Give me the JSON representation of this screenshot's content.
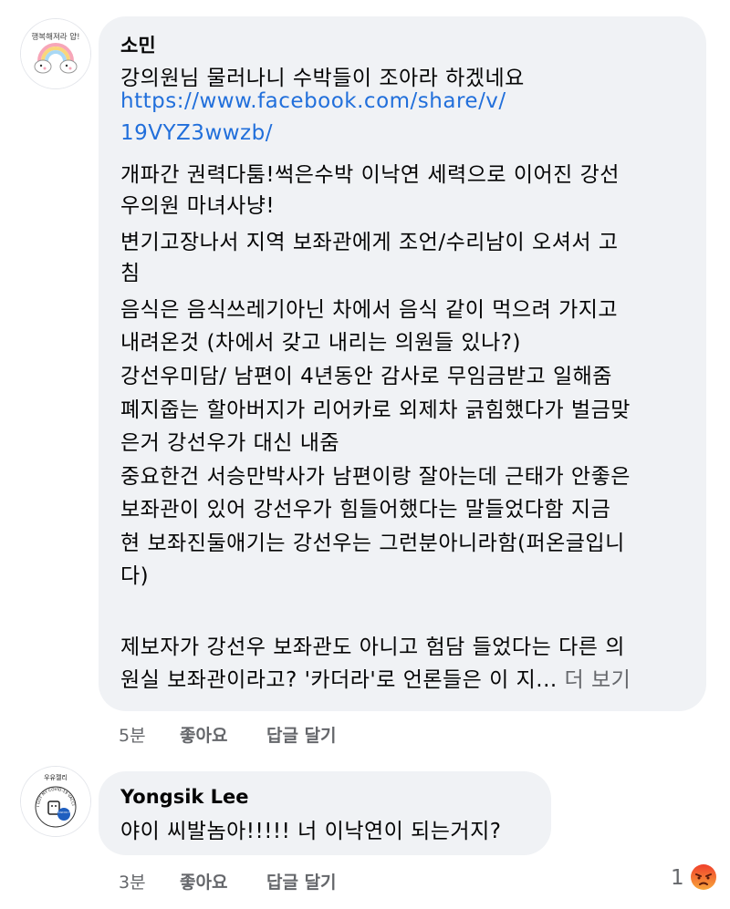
{
  "comments": [
    {
      "author": "소민",
      "avatar_icon": "rainbow-unicorn-avatar-icon",
      "avatar_text": "행복해져라 얍!",
      "text": {
        "l1": "강의원님 물러나니 수박들이 조아라 하겠네요",
        "l2": "https://www.facebook.com/share/v/",
        "l3": "19VYZ3wwzb/",
        "l4": "개파간 권력다툼!썩은수박 이낙연 세력으로 이어진 강선",
        "l5": "우의원 마녀사냥!",
        "l6": "변기고장나서 지역 보좌관에게 조언/수리남이 오셔서 고",
        "l7": "침",
        "l8": "음식은 음식쓰레기아닌 차에서 음식 같이 먹으려 가지고",
        "l9": "내려온것 (차에서 갖고 내리는 의원들 있나?)",
        "l10": "강선우미담/ 남편이 4년동안 감사로  무임금받고 일해줌",
        "l11": "폐지줍는 할아버지가 리어카로 외제차 긁힘했다가 벌금맞",
        "l12": "은거 강선우가 대신 내줌",
        "l13": "중요한건 서승만박사가 남편이랑 잘아는데 근태가 안좋은",
        "l14": "보좌관이 있어 강선우가 힘들어했다는 말들었다함 지금",
        "l15": "현 보좌진둘애기는 강선우는 그런분아니라함(퍼온글입니",
        "l16": "다)",
        "l17": "제보자가 강선우 보좌관도 아니고 험담 들었다는 다른 의",
        "l18": "원실 보좌관이라고? '카더라'로 언론들은 이 지...",
        "more": "더 보기"
      },
      "time": "5분",
      "like": "좋아요",
      "reply": "답글 달기"
    },
    {
      "author": "Yongsik Lee",
      "avatar_icon": "vaccine-sticker-avatar-icon",
      "avatar_text": "우유젤리",
      "avatar_badge": "WE CAN DO THIS",
      "avatar_ring": "I GOT MY COVID-19 VACCINE",
      "text": {
        "l1": "야이 씨발놈아!!!!! 너 이낙연이 되는거지?"
      },
      "time": "3분",
      "like": "좋아요",
      "reply": "답글 달기",
      "reaction_count": "1",
      "reaction_icon": "angry-emoji-icon"
    }
  ],
  "colors": {
    "bubble": "#f0f2f5",
    "link": "#216fdb",
    "meta": "#65676b",
    "text": "#050505"
  }
}
